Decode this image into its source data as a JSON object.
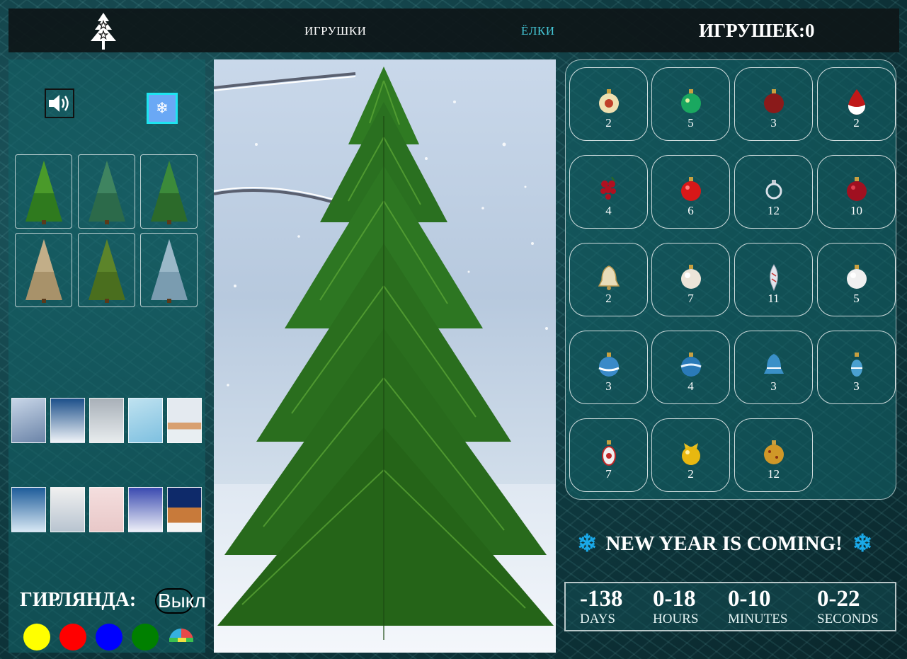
{
  "header": {
    "nav_toys": "ИГРУШКИ",
    "nav_trees": "ЁЛКИ",
    "counter_label": "ИГРУШЕК:",
    "counter_value": "0"
  },
  "colors": {
    "accent": "#45c8d8",
    "snow_button_border": "#1ee4f0",
    "flake": "#1aa9e8"
  },
  "left": {
    "icons": [
      "speaker-icon",
      "snowflake-icon"
    ],
    "tree_count": 6,
    "background_count": 10,
    "garland_label": "ГИРЛЯНДА:",
    "garland_toggle": "Выкл",
    "garland_colors": [
      "#ffff00",
      "#ff0000",
      "#0000ff",
      "#008000",
      "multicolor"
    ]
  },
  "toys": [
    {
      "count": "2"
    },
    {
      "count": "5"
    },
    {
      "count": "3"
    },
    {
      "count": "2"
    },
    {
      "count": "4"
    },
    {
      "count": "6"
    },
    {
      "count": "12"
    },
    {
      "count": "10"
    },
    {
      "count": "2"
    },
    {
      "count": "7"
    },
    {
      "count": "11"
    },
    {
      "count": "5"
    },
    {
      "count": "3"
    },
    {
      "count": "4"
    },
    {
      "count": "3"
    },
    {
      "count": "3"
    },
    {
      "count": "7"
    },
    {
      "count": "2"
    },
    {
      "count": "12"
    }
  ],
  "countdown": {
    "title": "NEW YEAR IS COMING!",
    "days_value": "-138",
    "days_label": "DAYS",
    "hours_value": "0-18",
    "hours_label": "HOURS",
    "minutes_value": "0-10",
    "minutes_label": "MINUTES",
    "seconds_value": "0-22",
    "seconds_label": "SECONDS"
  }
}
